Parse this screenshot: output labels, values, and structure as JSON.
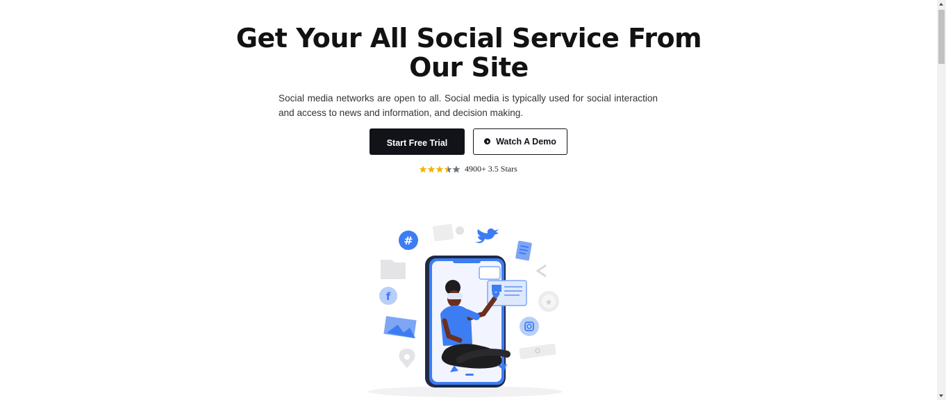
{
  "hero": {
    "title_line1": "Get Your All Social Service From",
    "title_line2": "Our Site",
    "description": "Social media networks are open to all. Social media is typically used for social interaction and access to news and information, and decision making."
  },
  "buttons": {
    "primary_label": "Start Free Trial",
    "secondary_label": "Watch A Demo",
    "secondary_icon": "play-circle-icon"
  },
  "rating": {
    "stars_value": 3.5,
    "stars_max": 5,
    "text": "4900+ 3.5 Stars",
    "star_color": "#f4b400",
    "star_empty_color": "#6b7280"
  },
  "illustration": {
    "subject": "person-on-phone-social-media-illustration",
    "accent_color": "#3d7df3"
  },
  "colors": {
    "primary_button_bg": "#111318",
    "text": "#121212"
  }
}
